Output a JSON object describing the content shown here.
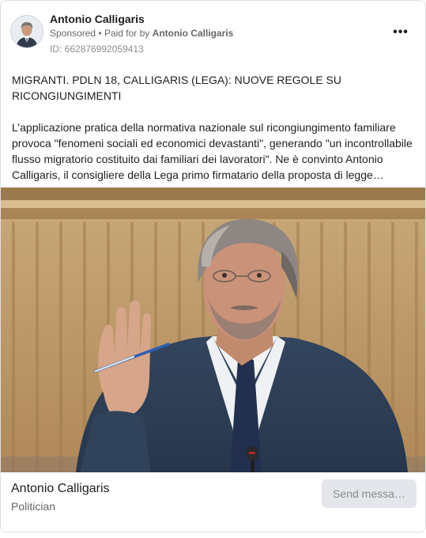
{
  "ad": {
    "page_name": "Antonio Calligaris",
    "sponsored_label": "Sponsored",
    "separator": "•",
    "paid_for_label": "Paid for by",
    "paid_for_name": "Antonio Calligaris",
    "ad_id": "ID: 662876992059413",
    "more_icon": "more-horizontal-icon",
    "more_glyph": "•••"
  },
  "body": {
    "headline": "MIGRANTI. PDLN 18, CALLIGARIS (LEGA): NUOVE REGOLE SU RICONGIUNGIMENTI",
    "text": "L’applicazione pratica della normativa nazionale sul ricongiungimento familiare provoca \"fenomeni sociali ed economici devastanti\", generando \"un incontrollabile flusso migratorio costituito dai familiari dei lavoratori\". Ne è convinto Antonio Calligaris, il consigliere della Lega primo firmatario della proposta di legge…"
  },
  "footer": {
    "name": "Antonio Calligaris",
    "category": "Politician",
    "cta_label": "Send messa…"
  },
  "colors": {
    "text_primary": "#1c1e21",
    "text_secondary": "#65676b",
    "button_bg": "#e4e6eb"
  }
}
